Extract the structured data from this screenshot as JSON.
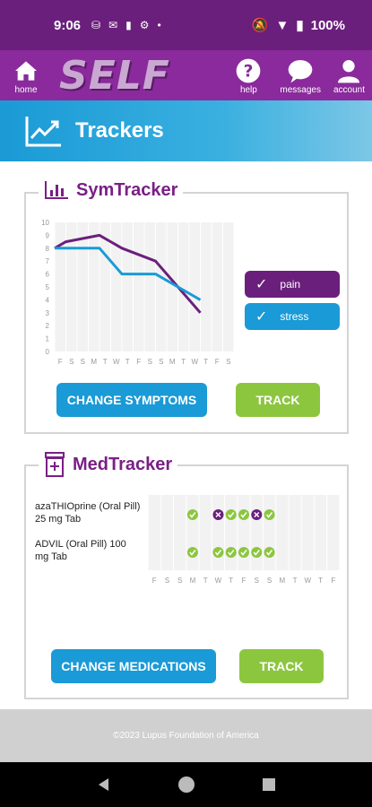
{
  "status": {
    "time": "9:06",
    "battery": "100%"
  },
  "nav": {
    "home": "home",
    "help": "help",
    "messages": "messages",
    "account": "account",
    "logo": "SELF"
  },
  "banner": {
    "title": "Trackers"
  },
  "symtracker": {
    "title": "SymTracker",
    "change_button": "CHANGE SYMPTOMS",
    "track_button": "TRACK",
    "legend": [
      {
        "label": "pain",
        "color": "#6b1f7c"
      },
      {
        "label": "stress",
        "color": "#1a9ad6"
      }
    ]
  },
  "medtracker": {
    "title": "MedTracker",
    "meds": [
      "azaTHIOprine (Oral Pill) 25 mg Tab",
      "ADVIL (Oral Pill) 100 mg Tab"
    ],
    "day_labels": [
      "F",
      "S",
      "S",
      "M",
      "T",
      "W",
      "T",
      "F",
      "S",
      "S",
      "M",
      "T",
      "W",
      "T",
      "F"
    ],
    "grid": [
      [
        "",
        "",
        "",
        "taken",
        "",
        "missed",
        "taken",
        "taken",
        "missed",
        "taken",
        "",
        "",
        "",
        "",
        ""
      ],
      [
        "",
        "",
        "",
        "taken",
        "",
        "taken",
        "taken",
        "taken",
        "taken",
        "taken",
        "",
        "",
        "",
        "",
        ""
      ]
    ],
    "change_button": "CHANGE MEDICATIONS",
    "track_button": "TRACK"
  },
  "chart_data": {
    "type": "line",
    "categories": [
      "F",
      "S",
      "S",
      "M",
      "T",
      "W",
      "T",
      "F",
      "S",
      "S",
      "M",
      "T",
      "W",
      "T",
      "F",
      "S"
    ],
    "yticks": [
      "0",
      "1",
      "2",
      "3",
      "4",
      "5",
      "6",
      "7",
      "8",
      "9",
      "10"
    ],
    "ylim": [
      0,
      10
    ],
    "series": [
      {
        "name": "pain",
        "color": "#6b1f7c",
        "values": [
          8,
          8.5,
          null,
          null,
          9,
          null,
          8,
          null,
          null,
          7,
          null,
          5,
          null,
          3
        ]
      },
      {
        "name": "stress",
        "color": "#1a9ad6",
        "values": [
          8,
          8,
          null,
          null,
          8,
          null,
          6,
          null,
          null,
          6,
          null,
          5,
          null,
          4
        ]
      }
    ]
  },
  "footer": {
    "text": "©2023 Lupus Foundation of America"
  }
}
